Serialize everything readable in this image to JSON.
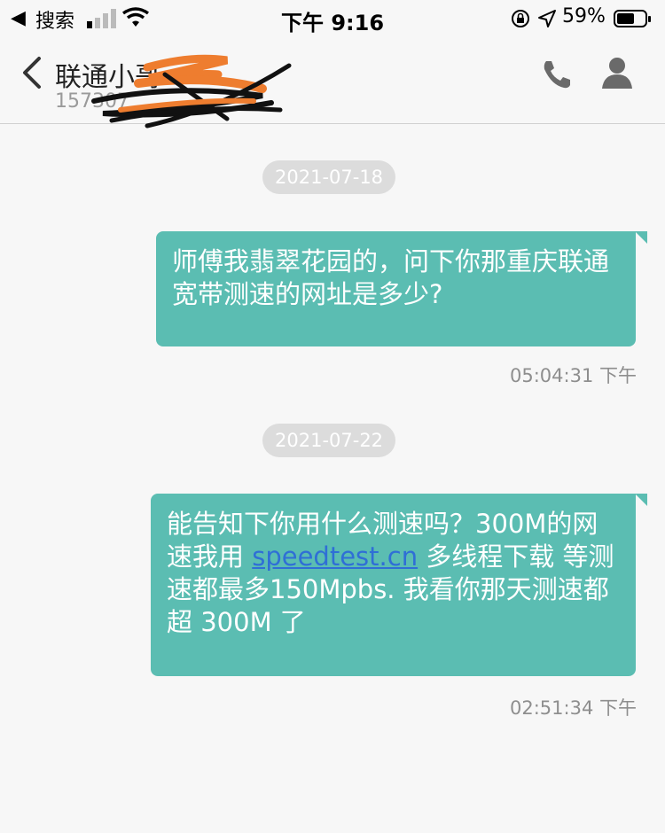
{
  "status_bar": {
    "back_label": "◀",
    "carrier": "搜索",
    "time": "下午 9:16",
    "battery": "59%"
  },
  "header": {
    "contact_name": "联通小哥",
    "contact_number": "157307"
  },
  "messages": [
    {
      "date": "2021-07-18",
      "text": "师傅我翡翠花园的，问下你那重庆联通宽带测速的网址是多少?",
      "time": "05:04:31 下午"
    },
    {
      "date": "2021-07-22",
      "text_before_link": "能告知下你用什么测速吗？300M的网速我用",
      "link_text": "speedtest.cn",
      "text_after_link": " 多线程下载 等测速都最多150Mpbs. 我看你那天测速都超 300M 了",
      "time": "02:51:34 下午"
    }
  ],
  "colors": {
    "bubble": "#5bbdb2",
    "link": "#2f6fd6",
    "date_pill": "#dcdcdc",
    "timestamp": "#8e8e8e"
  }
}
